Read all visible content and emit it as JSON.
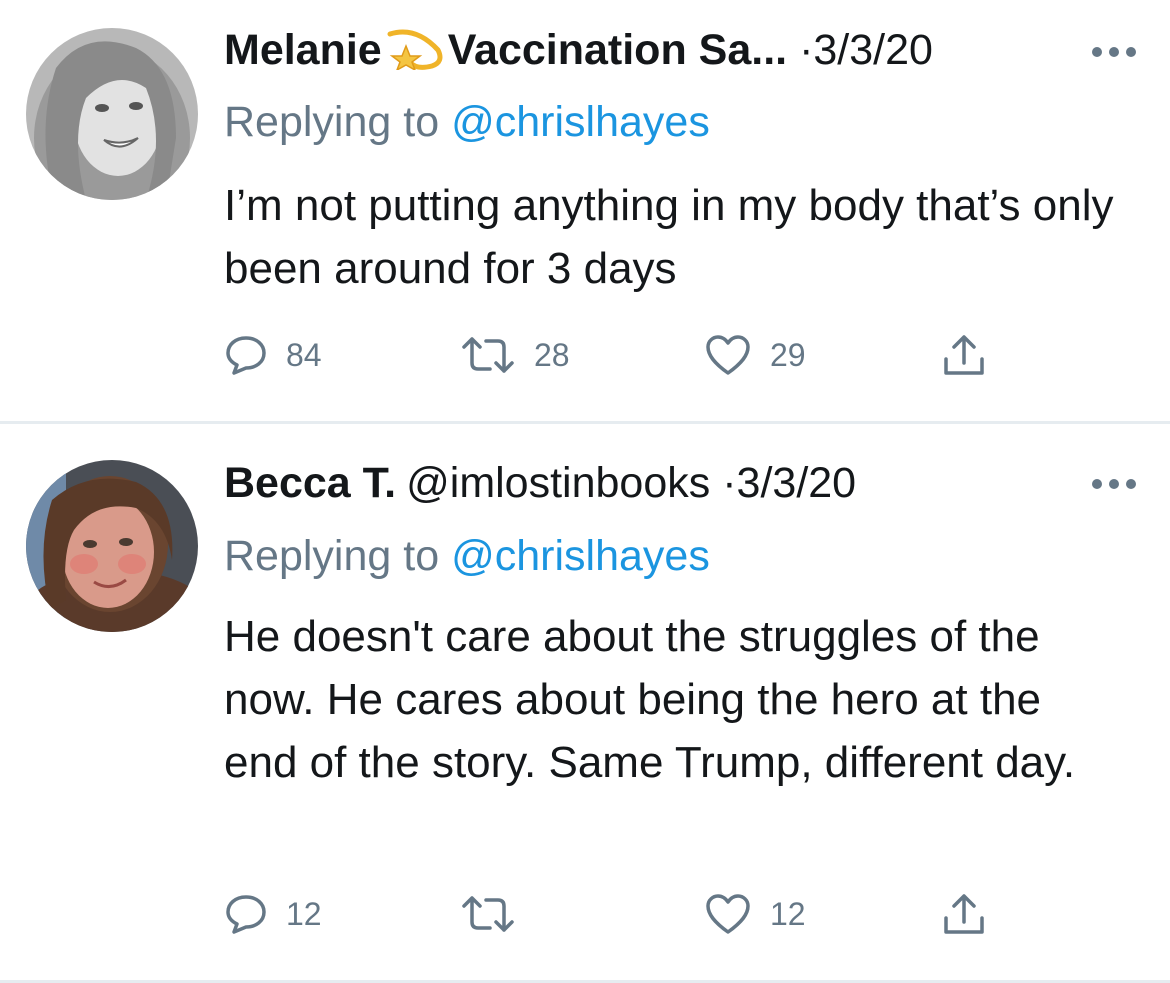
{
  "tweets": [
    {
      "display_name": "Melanie",
      "display_name_suffix": "Vaccination Sa...",
      "name_emoji": "dizzy-star-emoji",
      "handle": "",
      "dot": "·",
      "date": "3/3/20",
      "replying_prefix": "Replying to ",
      "replying_handle": "@chrislhayes",
      "text": "I’m not putting anything in my body that’s only been around for 3 days",
      "reply_count": "84",
      "retweet_count": "28",
      "like_count": "29"
    },
    {
      "display_name": "Becca T.",
      "handle": "@imlostinbooks",
      "dot": "·",
      "date": "3/3/20",
      "replying_prefix": "Replying to ",
      "replying_handle": "@chrislhayes",
      "text": "He doesn't care about the struggles of the now. He cares about being the hero at the end of the story. Same Trump, different day.",
      "reply_count": "12",
      "retweet_count": "",
      "like_count": "12"
    }
  ],
  "colors": {
    "text_primary": "#14171a",
    "text_secondary": "#657786",
    "link": "#1b95e0",
    "divider": "#e6ecf0"
  },
  "icons": {
    "reply": "reply-bubble-icon",
    "retweet": "retweet-icon",
    "like": "heart-icon",
    "share": "share-icon",
    "more": "more-dots-icon"
  }
}
